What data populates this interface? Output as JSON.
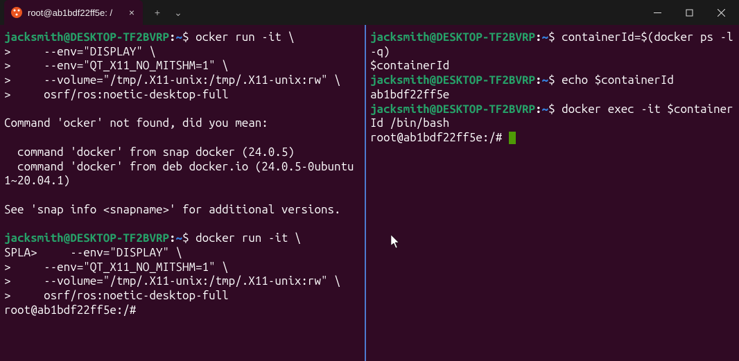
{
  "tab": {
    "title": "root@ab1bdf22ff5e: /",
    "close": "×"
  },
  "titlebar": {
    "plus": "+",
    "chevron": "⌄"
  },
  "left_pane": {
    "p1_user": "jacksmith@DESKTOP-TF2BVRP",
    "p1_path": "~",
    "p1_cmd": "ocker run -it \\",
    "p1_l2": ">     --env=\"DISPLAY\" \\",
    "p1_l3": ">     --env=\"QT_X11_NO_MITSHM=1\" \\",
    "p1_l4": ">     --volume=\"/tmp/.X11-unix:/tmp/.X11-unix:rw\" \\",
    "p1_l5": ">     osrf/ros:noetic-desktop-full",
    "err_head": "Command 'ocker' not found, did you mean:",
    "err_s1": "  command 'docker' from snap docker (24.0.5)",
    "err_s2": "  command 'docker' from deb docker.io (24.0.5-0ubuntu1~20.04.1)",
    "err_foot": "See 'snap info <snapname>' for additional versions.",
    "p2_user": "jacksmith@DESKTOP-TF2BVRP",
    "p2_path": "~",
    "p2_cmd": "docker run -it \\",
    "p2_l2": "SPLA>     --env=\"DISPLAY\" \\",
    "p2_l3": ">     --env=\"QT_X11_NO_MITSHM=1\" \\",
    "p2_l4": ">     --volume=\"/tmp/.X11-unix:/tmp/.X11-unix:rw\" \\",
    "p2_l5": ">     osrf/ros:noetic-desktop-full",
    "p2_root": "root@ab1bdf22ff5e:/#"
  },
  "right_pane": {
    "r1_user": "jacksmith@DESKTOP-TF2BVRP",
    "r1_path": "~",
    "r1_cmd": "containerId=$(docker ps -l -q)",
    "r1_out": "$containerId",
    "r2_user": "jacksmith@DESKTOP-TF2BVRP",
    "r2_path": "~",
    "r2_cmd": "echo $containerId",
    "r2_out": "ab1bdf22ff5e",
    "r3_user": "jacksmith@DESKTOP-TF2BVRP",
    "r3_path": "~",
    "r3_cmd": "docker exec -it $containerId /bin/bash",
    "r3_root": "root@ab1bdf22ff5e:/# "
  }
}
